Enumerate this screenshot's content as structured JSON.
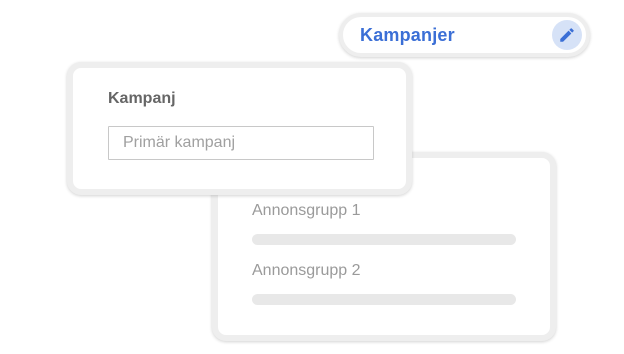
{
  "header": {
    "title": "Kampanjer",
    "edit_icon": "pencil-icon",
    "accent_color": "#3b6fd6",
    "edit_bg_color": "#d6e2f7"
  },
  "campaign": {
    "label": "Kampanj",
    "input_placeholder": "Primär kampanj",
    "input_value": ""
  },
  "ad_groups": {
    "items": [
      {
        "label": "Annonsgrupp 1"
      },
      {
        "label": "Annonsgrupp 2"
      }
    ]
  }
}
